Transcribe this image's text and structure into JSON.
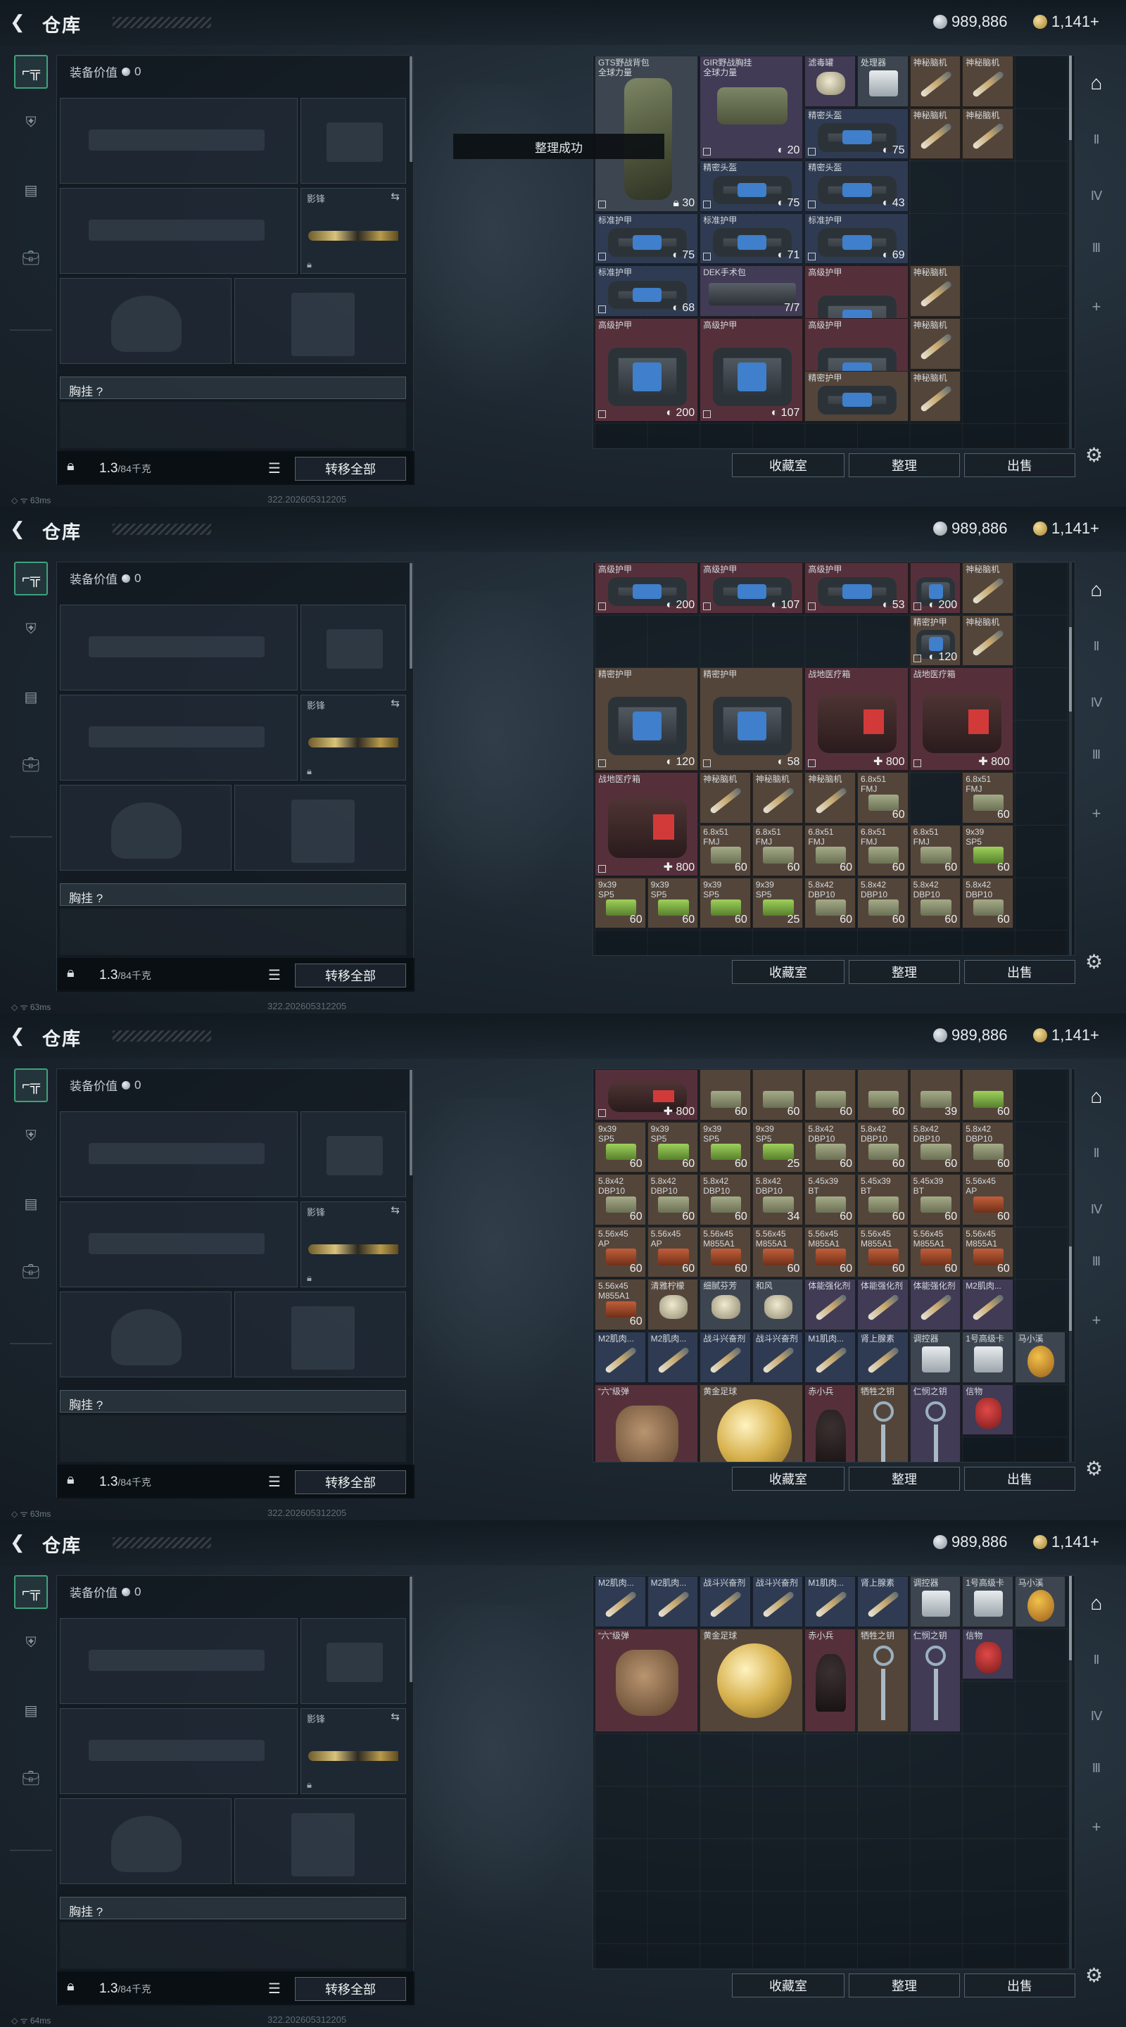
{
  "header": {
    "title": "仓库",
    "silver": "989,886",
    "gold": "1,141+"
  },
  "equipment": {
    "value_label": "装备价值",
    "value": "0",
    "slot_knife_label": "影锋",
    "chest_label": "胸挂 ?",
    "weight": "1.3",
    "weight_max": "/84千克",
    "transfer_all": "转移全部"
  },
  "stash_buttons": {
    "collection": "收藏室",
    "sort": "整理",
    "sell": "出售"
  },
  "toast": "整理成功",
  "status": {
    "ping1": "63ms",
    "ping4": "64ms",
    "build": "322.202605312205"
  },
  "colors": {
    "accent": "#3ea37c",
    "gray": "#3d4650",
    "purple": "#413b55",
    "red": "#55303a",
    "gold": "#54453a"
  },
  "items": {
    "backpack": {
      "name": "GTS野战背包\n全球力量",
      "val": "30"
    },
    "rig": {
      "name": "GIR野战胸挂\n全球力量",
      "val": "20"
    },
    "filter": {
      "name": "滤毒罐"
    },
    "processor": {
      "name": "处理器"
    },
    "brain": {
      "name": "神秘脑机"
    },
    "helmet": {
      "name": "精密头盔"
    },
    "armor_std": {
      "name": "标准护甲"
    },
    "armor_adv": {
      "name": "高级护甲"
    },
    "armor_prec": {
      "name": "精密护甲"
    },
    "dek": {
      "name": "DEK手术包",
      "val": "7/7"
    },
    "medkit": {
      "name": "战地医疗箱",
      "val": "800"
    },
    "v75": "75",
    "v43": "43",
    "v71": "71",
    "v69": "69",
    "v68": "68",
    "v200": "200",
    "v107": "107",
    "v53": "53",
    "v120": "120",
    "v58": "58",
    "a68": {
      "name": "6.8x51\nFMJ"
    },
    "a939": {
      "name": "9x39\nSP5"
    },
    "a58": {
      "name": "5.8x42\nDBP10"
    },
    "a545": {
      "name": "5.45x39\nBT"
    },
    "a556ap": {
      "name": "5.56x45\nAP"
    },
    "a556": {
      "name": "5.56x45\nM855A1"
    },
    "n60": "60",
    "n39": "39",
    "n25": "25",
    "n34": "34",
    "lemon": {
      "name": "清雅柠檬"
    },
    "fentanyl": {
      "name": "细腻芬芳"
    },
    "wind": {
      "name": "和风"
    },
    "stim_body": {
      "name": "体能强化剂"
    },
    "stim_m2": {
      "name": "M2肌肉..."
    },
    "stim_battle": {
      "name": "战斗兴奋剂"
    },
    "stim_m1": {
      "name": "M1肌肉..."
    },
    "stim_adrenal": {
      "name": "肾上腺素"
    },
    "tuner": {
      "name": "调控器"
    },
    "card1": {
      "name": "1号高级卡"
    },
    "horse": {
      "name": "马小溪"
    },
    "glove": {
      "name": "“六”级弹"
    },
    "ball": {
      "name": "黄金足球"
    },
    "chibi": {
      "name": "赤小兵"
    },
    "key_sac": {
      "name": "牺牲之钥"
    },
    "key_mercy": {
      "name": "仁悯之钥"
    },
    "token": {
      "name": "信物"
    }
  }
}
